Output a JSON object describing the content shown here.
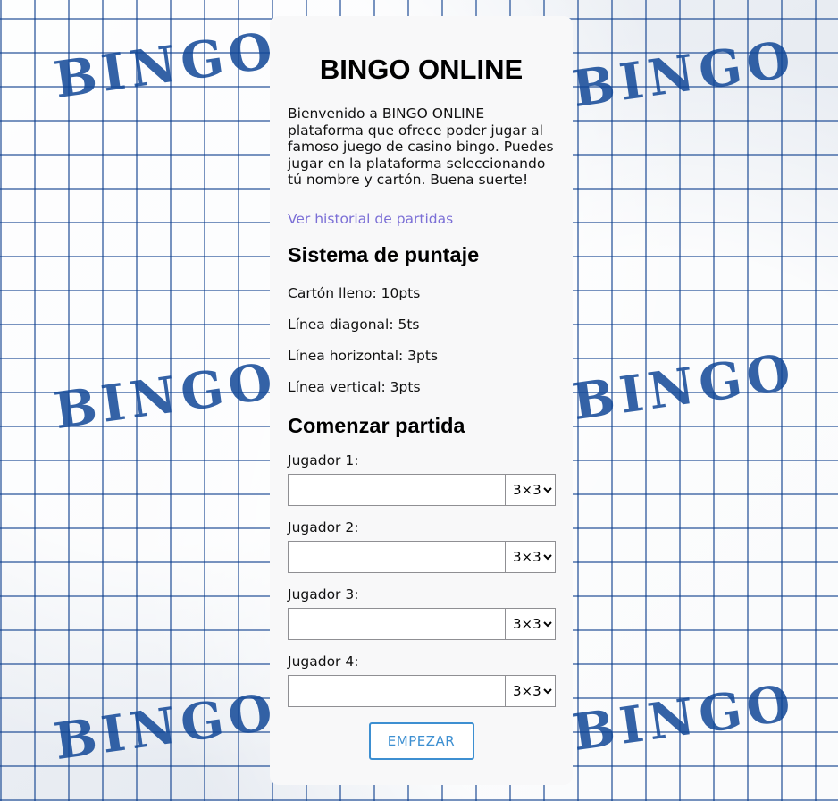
{
  "page": {
    "title": "BINGO ONLINE",
    "intro": "Bienvenido a BINGO ONLINE plataforma que ofrece poder jugar al famoso juego de casino bingo. Puedes jugar en la plataforma seleccionando tú nombre y cartón. Buena suerte!",
    "history_link": "Ver historial de partidas"
  },
  "scoring": {
    "title": "Sistema de puntaje",
    "items": [
      "Cartón lleno: 10pts",
      "Línea diagonal: 5ts",
      "Línea horizontal: 3pts",
      "Línea vertical: 3pts"
    ]
  },
  "game": {
    "title": "Comenzar partida",
    "players": [
      {
        "label": "Jugador 1:",
        "value": "",
        "card_size": "3×3"
      },
      {
        "label": "Jugador 2:",
        "value": "",
        "card_size": "3×3"
      },
      {
        "label": "Jugador 3:",
        "value": "",
        "card_size": "3×3"
      },
      {
        "label": "Jugador 4:",
        "value": "",
        "card_size": "3×3"
      }
    ],
    "start_button": "EMPEZAR"
  },
  "background": {
    "word": "BINGO",
    "accent_color": "#104796"
  },
  "colors": {
    "panel": "#f8f8f9",
    "link": "#7b6fd6",
    "button": "#3d8fd1"
  }
}
